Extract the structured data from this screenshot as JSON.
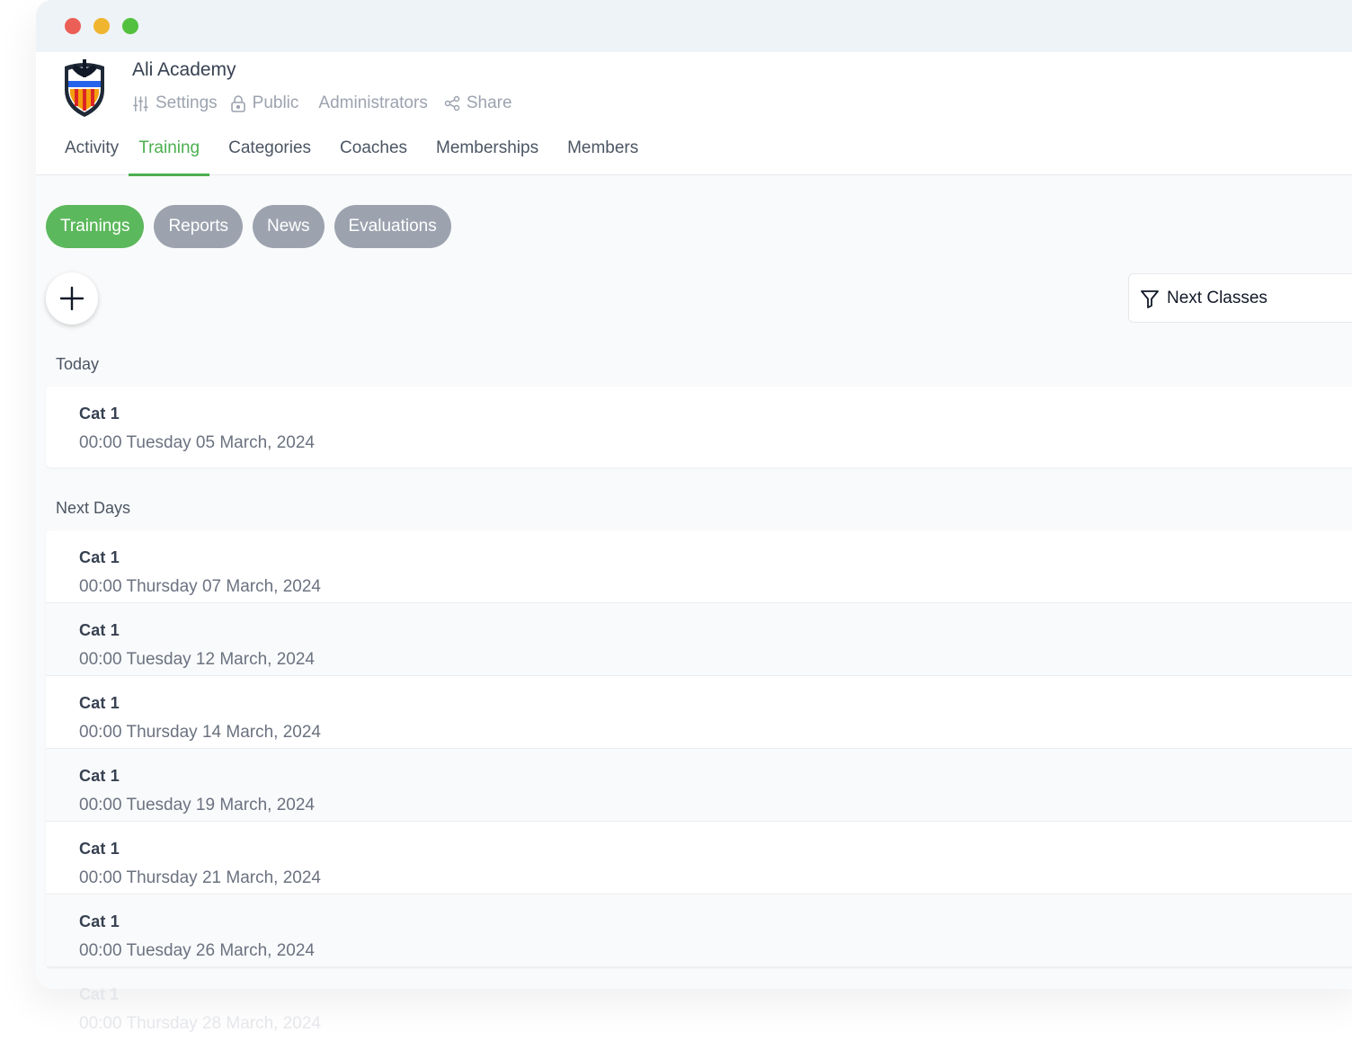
{
  "window": {
    "traffic_lights": [
      "close",
      "minimize",
      "maximize"
    ]
  },
  "header": {
    "club_name": "Ali Academy",
    "quick_links": [
      {
        "label": "Settings",
        "icon": "sliders-icon"
      },
      {
        "label": "Public",
        "icon": "lock-open-icon"
      },
      {
        "label": "Administrators",
        "icon": ""
      },
      {
        "label": "Share",
        "icon": "share-icon"
      }
    ],
    "tabs": [
      "Activity",
      "Training",
      "Categories",
      "Coaches",
      "Memberships",
      "Members"
    ],
    "active_tab": "Training"
  },
  "subtabs": [
    "Trainings",
    "Reports",
    "News",
    "Evaluations"
  ],
  "active_subtab": "Trainings",
  "filter": {
    "label": "Next Classes",
    "icon": "filter-icon"
  },
  "today": {
    "label": "Today",
    "items": [
      {
        "name": "Cat 1",
        "date": "00:00 Tuesday 05 March, 2024"
      }
    ]
  },
  "next_days": {
    "label": "Next Days",
    "items": [
      {
        "name": "Cat 1",
        "date": "00:00 Thursday 07 March, 2024"
      },
      {
        "name": "Cat 1",
        "date": "00:00 Tuesday 12 March, 2024"
      },
      {
        "name": "Cat 1",
        "date": "00:00 Thursday 14 March, 2024"
      },
      {
        "name": "Cat 1",
        "date": "00:00 Tuesday 19 March, 2024"
      },
      {
        "name": "Cat 1",
        "date": "00:00 Thursday 21 March, 2024"
      },
      {
        "name": "Cat 1",
        "date": "00:00 Tuesday 26 March, 2024"
      }
    ],
    "faded_item": {
      "name": "Cat 1",
      "date": "00:00 Thursday 28 March, 2024"
    }
  },
  "colors": {
    "accent": "#4caf50",
    "pill_active": "#5cb85c",
    "pill_inactive": "#9ca3af"
  }
}
